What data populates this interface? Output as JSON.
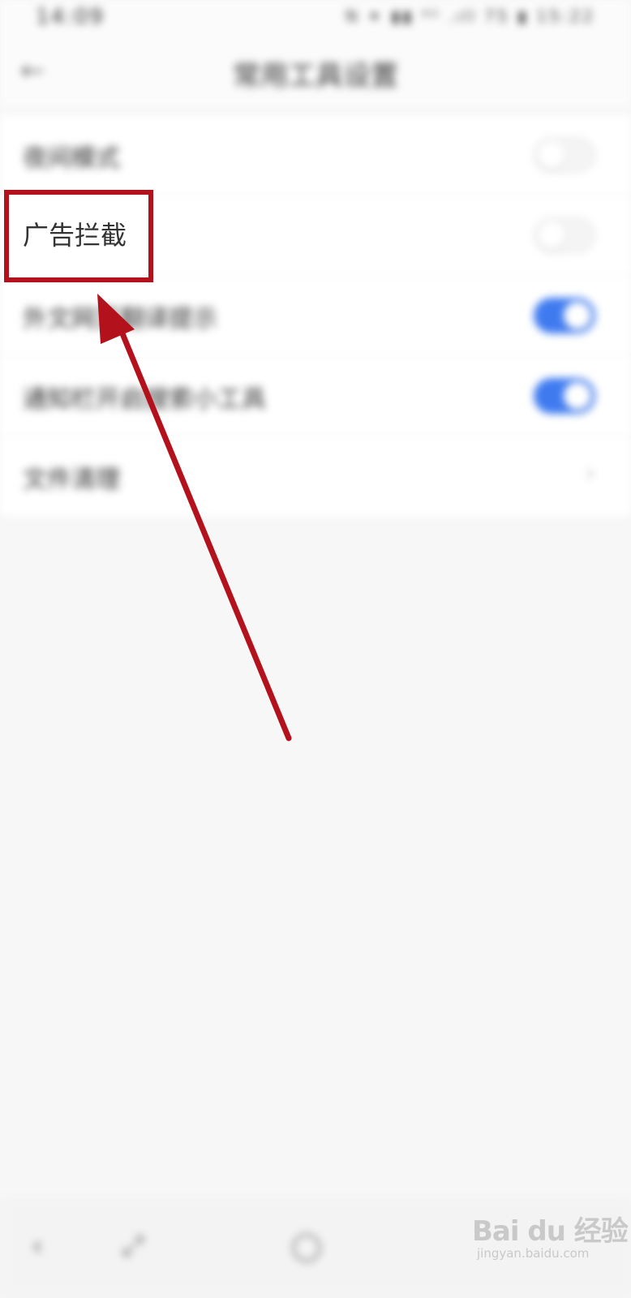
{
  "status_bar": {
    "time": "14:09",
    "icons_text": "N ✦ ▮▮ ⁴ᴳ .ıll 75 ▮ 15:22"
  },
  "header": {
    "title": "常用工具设置"
  },
  "settings": [
    {
      "label": "夜间模式",
      "control": "toggle",
      "on": false
    },
    {
      "label": "广告拦截",
      "control": "toggle",
      "on": false
    },
    {
      "label": "外文网页翻译提示",
      "control": "toggle",
      "on": true
    },
    {
      "label": "通知栏开启搜索小工具",
      "control": "toggle",
      "on": true
    },
    {
      "label": "文件清理",
      "control": "chevron"
    }
  ],
  "highlight": {
    "label": "广告拦截",
    "color": "#b3121d"
  },
  "watermark": {
    "brand": "Bai du 经验",
    "sub": "jingyan.baidu.com"
  },
  "colors": {
    "toggle_on": "#3f7bf0",
    "annotation_red": "#b3121d"
  }
}
